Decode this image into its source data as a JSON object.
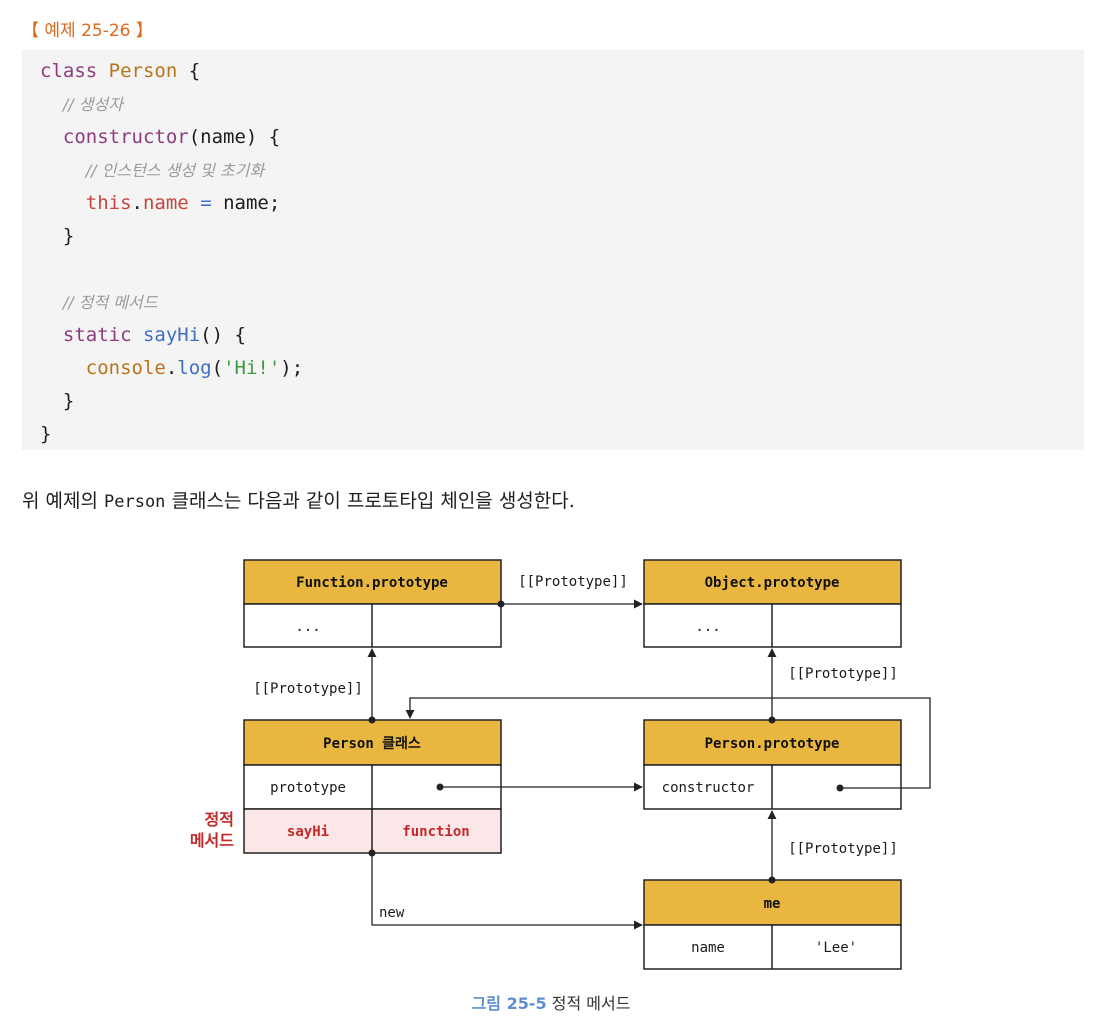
{
  "example": {
    "label": "【 예제 25-26 】"
  },
  "code": {
    "lines": [
      [
        {
          "t": "class ",
          "c": "tok-kw"
        },
        {
          "t": "Person",
          "c": "tok-cls"
        },
        {
          "t": " {",
          "c": "tok-plain"
        }
      ],
      [
        {
          "t": "  ",
          "c": "tok-plain"
        },
        {
          "t": "// 생성자",
          "c": "tok-cm"
        }
      ],
      [
        {
          "t": "  ",
          "c": "tok-plain"
        },
        {
          "t": "constructor",
          "c": "tok-kw"
        },
        {
          "t": "(name) {",
          "c": "tok-plain"
        }
      ],
      [
        {
          "t": "    ",
          "c": "tok-plain"
        },
        {
          "t": "// 인스턴스 생성 및 초기화",
          "c": "tok-cm"
        }
      ],
      [
        {
          "t": "    ",
          "c": "tok-plain"
        },
        {
          "t": "this",
          "c": "tok-this"
        },
        {
          "t": ".",
          "c": "tok-plain"
        },
        {
          "t": "name",
          "c": "tok-this"
        },
        {
          "t": " = ",
          "c": "tok-fn"
        },
        {
          "t": "name;",
          "c": "tok-plain"
        }
      ],
      [
        {
          "t": "  }",
          "c": "tok-plain"
        }
      ],
      [
        {
          "t": "",
          "c": "tok-plain"
        }
      ],
      [
        {
          "t": "  ",
          "c": "tok-plain"
        },
        {
          "t": "// 정적 메서드",
          "c": "tok-cm"
        }
      ],
      [
        {
          "t": "  ",
          "c": "tok-plain"
        },
        {
          "t": "static ",
          "c": "tok-kw"
        },
        {
          "t": "sayHi",
          "c": "tok-fn"
        },
        {
          "t": "() {",
          "c": "tok-plain"
        }
      ],
      [
        {
          "t": "    ",
          "c": "tok-plain"
        },
        {
          "t": "console",
          "c": "tok-cls"
        },
        {
          "t": ".",
          "c": "tok-plain"
        },
        {
          "t": "log",
          "c": "tok-fn"
        },
        {
          "t": "(",
          "c": "tok-plain"
        },
        {
          "t": "'Hi!'",
          "c": "tok-str"
        },
        {
          "t": ");",
          "c": "tok-plain"
        }
      ],
      [
        {
          "t": "  }",
          "c": "tok-plain"
        }
      ],
      [
        {
          "t": "}",
          "c": "tok-plain"
        }
      ]
    ]
  },
  "paragraph": {
    "before": "위 예제의 ",
    "code": "Person",
    "after": " 클래스는 다음과 같이 프로토타입 체인을 생성한다."
  },
  "diagram": {
    "function_prototype": {
      "title": "Function.prototype",
      "cell1": "...",
      "cell2": ""
    },
    "object_prototype": {
      "title": "Object.prototype",
      "cell1": "...",
      "cell2": ""
    },
    "person_class": {
      "title": "Person 클래스",
      "row1_left": "prototype",
      "row2_left": "sayHi",
      "row2_right": "function"
    },
    "person_prototype": {
      "title": "Person.prototype",
      "row1_left": "constructor"
    },
    "me": {
      "title": "me",
      "row1_left": "name",
      "row1_right": "'Lee'"
    },
    "labels": {
      "proto_fp_op": "[[Prototype]]",
      "proto_pc_fp": "[[Prototype]]",
      "proto_pp_op": "[[Prototype]]",
      "proto_me_pp": "[[Prototype]]",
      "new": "new",
      "static_method_line1": "정적",
      "static_method_line2": "메서드"
    },
    "colors": {
      "header_fill": "#e9b640",
      "static_row_fill": "#fbe7e7",
      "static_text": "#c62828",
      "line": "#222222"
    }
  },
  "figure_caption": {
    "number": "그림 25-5",
    "title": "정적 메서드"
  }
}
